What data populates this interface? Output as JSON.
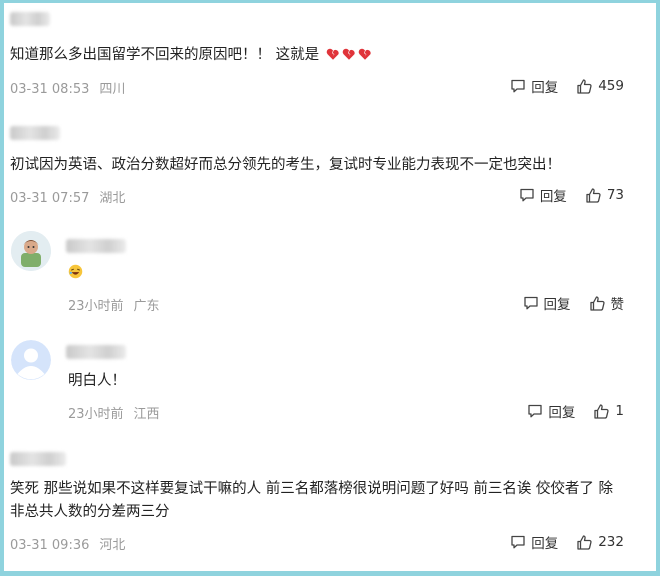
{
  "comments": [
    {
      "text": "知道那么多出国留学不回来的原因吧！！ 这就是",
      "time": "03-31 08:53",
      "location": "四川",
      "reply_label": "回复",
      "like_count": "459",
      "emoji": [
        "broken-heart-emoji",
        "broken-heart-emoji",
        "broken-heart-emoji"
      ]
    },
    {
      "text": "初试因为英语、政治分数超好而总分领先的考生，复试时专业能力表现不一定也突出！",
      "time": "03-31 07:57",
      "location": "湖北",
      "reply_label": "回复",
      "like_count": "73"
    },
    {
      "text": "",
      "emoji": [
        "laughing-emoji"
      ],
      "time": "23小时前",
      "location": "广东",
      "reply_label": "回复",
      "like_count": "赞"
    },
    {
      "text": "明白人！",
      "time": "23小时前",
      "location": "江西",
      "reply_label": "回复",
      "like_count": "1"
    },
    {
      "text_line1": "笑死 那些说如果不这样要复试干嘛的人 前三名都落榜很说明问题了好吗 前三名诶 佼佼者了 除",
      "text_line2": "非总共人数的分差两三分",
      "time": "03-31 09:36",
      "location": "河北",
      "reply_label": "回复",
      "like_count": "232"
    }
  ],
  "colors": {
    "border": "#8fd3de",
    "meta_text": "#9a9a9a",
    "body_text": "#222222",
    "heart_red": "#e0343a"
  }
}
